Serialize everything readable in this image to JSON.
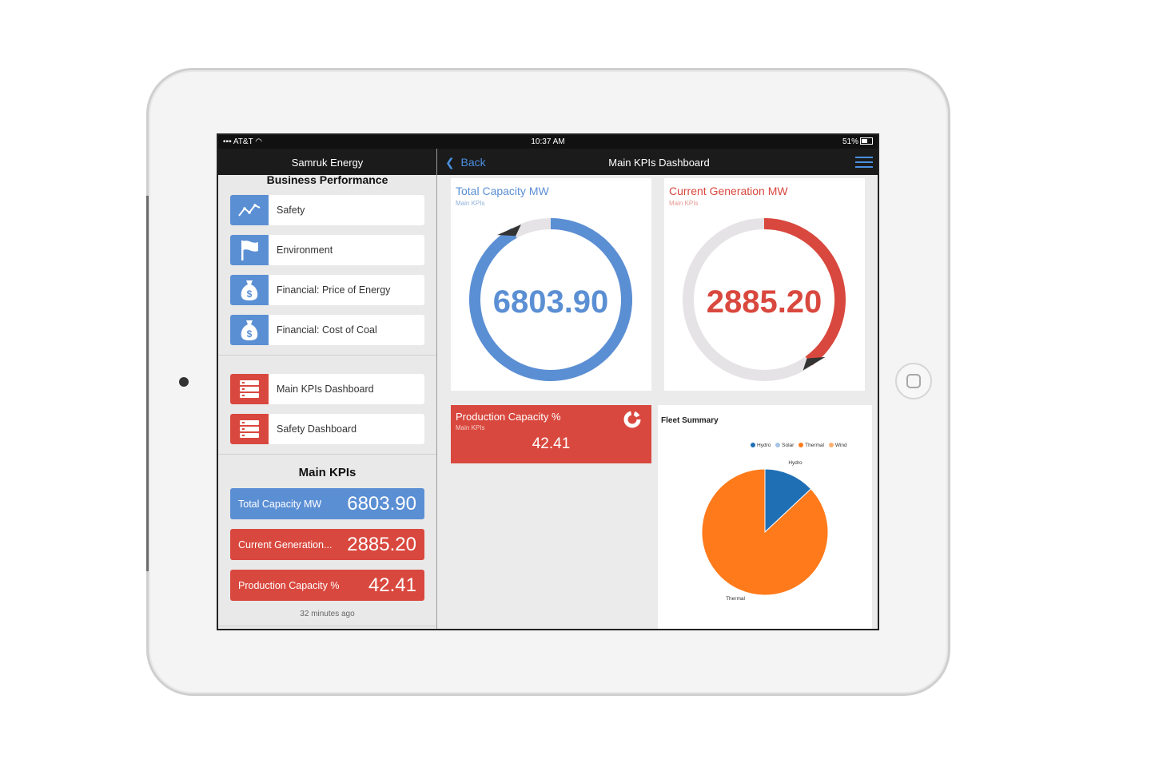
{
  "status_bar": {
    "carrier": "AT&T",
    "time": "10:37 AM",
    "battery": "51%"
  },
  "left_panel": {
    "app_title": "Samruk Energy",
    "section_title": "Business Performance",
    "items": [
      {
        "label": "Safety",
        "icon": "trend-line-icon",
        "color": "#5b8fd4"
      },
      {
        "label": "Environment",
        "icon": "flag-icon",
        "color": "#5b8fd4"
      },
      {
        "label": "Financial: Price of Energy",
        "icon": "money-bag-icon",
        "color": "#5b8fd4"
      },
      {
        "label": "Financial: Cost of Coal",
        "icon": "money-bag-icon",
        "color": "#5b8fd4"
      }
    ],
    "dashboards": [
      {
        "label": "Main KPIs Dashboard",
        "icon": "list-icon",
        "color": "#d9483e"
      },
      {
        "label": "Safety Dashboard",
        "icon": "list-icon",
        "color": "#d9483e"
      }
    ],
    "kpi_title": "Main KPIs",
    "kpis": [
      {
        "label": "Total Capacity MW",
        "value": "6803.90",
        "color": "#5b8fd4"
      },
      {
        "label": "Current Generation...",
        "value": "2885.20",
        "color": "#d9483e"
      },
      {
        "label": "Production Capacity %",
        "value": "42.41",
        "color": "#d9483e"
      }
    ],
    "updated": "32 minutes ago"
  },
  "main": {
    "back_label": "Back",
    "title": "Main KPIs Dashboard",
    "gauges": [
      {
        "title": "Total Capacity MW",
        "subtitle": "Main KPIs",
        "value": "6803.90",
        "fill_fraction": 0.92,
        "color": "#5b8fd4"
      },
      {
        "title": "Current Generation MW",
        "subtitle": "Main KPIs",
        "value": "2885.20",
        "fill_fraction": 0.4,
        "color": "#d9483e"
      }
    ],
    "production": {
      "title": "Production Capacity %",
      "subtitle": "Main KPIs",
      "value": "42.41"
    },
    "fleet": {
      "title": "Fleet Summary"
    }
  },
  "chart_data": {
    "type": "pie",
    "title": "Fleet Summary",
    "legend_position": "top-right",
    "categories": [
      "Hydro",
      "Solar",
      "Thermal",
      "Wind"
    ],
    "values": [
      13,
      0,
      87,
      0
    ],
    "colors": [
      "#1f6fb5",
      "#a6c4e6",
      "#ff7a1a",
      "#ffb070"
    ],
    "slice_labels": [
      "Hydro",
      "Thermal"
    ]
  }
}
